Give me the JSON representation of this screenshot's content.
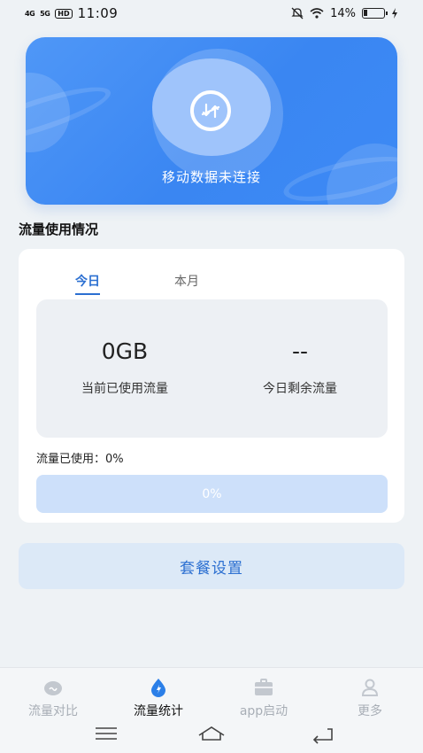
{
  "status_bar": {
    "signal1": "4G",
    "signal2": "5G",
    "hd": "HD",
    "time": "11:09",
    "battery": "14%"
  },
  "banner": {
    "status_text": "移动数据未连接"
  },
  "section_title": "流量使用情况",
  "tabs": [
    {
      "label": "今日",
      "active": true
    },
    {
      "label": "本月",
      "active": false
    }
  ],
  "stats": {
    "used_value": "0GB",
    "used_label": "当前已使用流量",
    "remaining_value": "--",
    "remaining_label": "今日剩余流量"
  },
  "usage": {
    "text": "流量已使用：0%",
    "progress_percent": 0,
    "progress_label": "0%"
  },
  "plan_button": "套餐设置",
  "bottom_nav": [
    {
      "label": "流量对比",
      "icon": "cloud-icon",
      "active": false
    },
    {
      "label": "流量统计",
      "icon": "drop-icon",
      "active": true
    },
    {
      "label": "app启动",
      "icon": "briefcase-icon",
      "active": false
    },
    {
      "label": "更多",
      "icon": "person-icon",
      "active": false
    }
  ],
  "colors": {
    "accent": "#2b6fd1",
    "banner": "#3a86f2",
    "progress_track": "#cde0fa"
  }
}
